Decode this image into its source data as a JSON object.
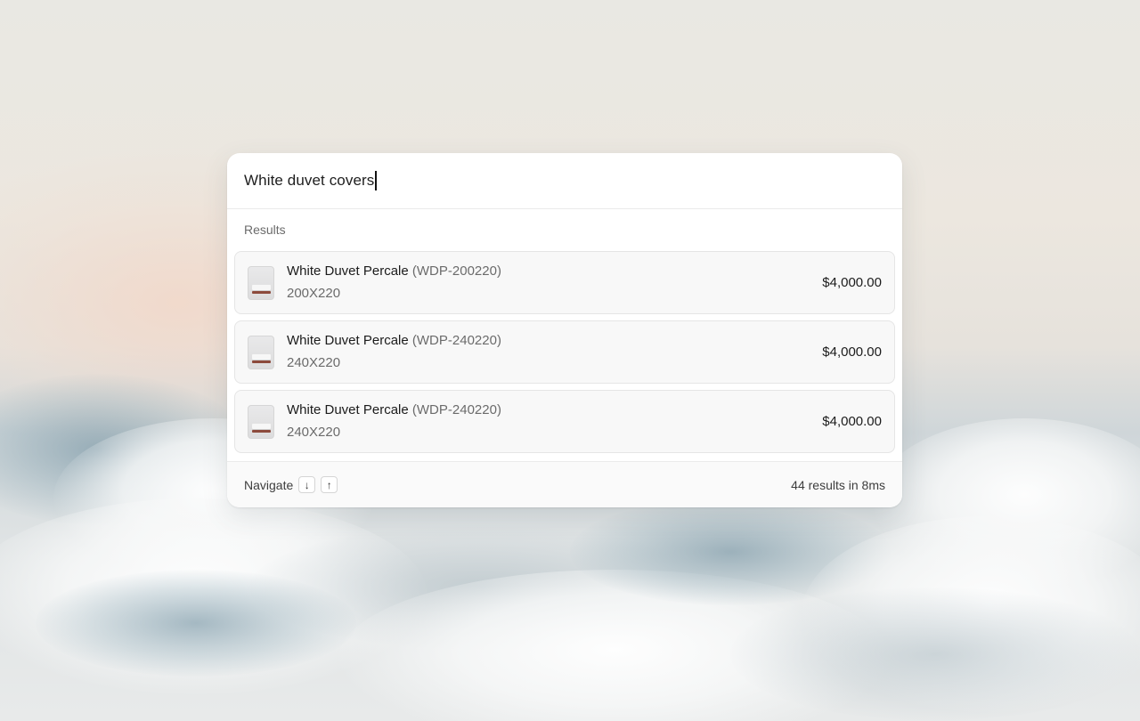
{
  "search": {
    "query": "White duvet covers"
  },
  "results_label": "Results",
  "results": [
    {
      "name": "White Duvet Percale",
      "sku": "(WDP-200220)",
      "size": "200X220",
      "price": "$4,000.00"
    },
    {
      "name": "White Duvet Percale",
      "sku": "(WDP-240220)",
      "size": "240X220",
      "price": "$4,000.00"
    },
    {
      "name": "White Duvet Percale",
      "sku": "(WDP-240220)",
      "size": "240X220",
      "price": "$4,000.00"
    }
  ],
  "footer": {
    "navigate_label": "Navigate",
    "down_key": "↓",
    "up_key": "↑",
    "stats": "44 results in 8ms"
  },
  "icons": {
    "thumbnail": "bed-product-thumbnail-icon",
    "down": "arrow-down-icon",
    "up": "arrow-up-icon"
  }
}
